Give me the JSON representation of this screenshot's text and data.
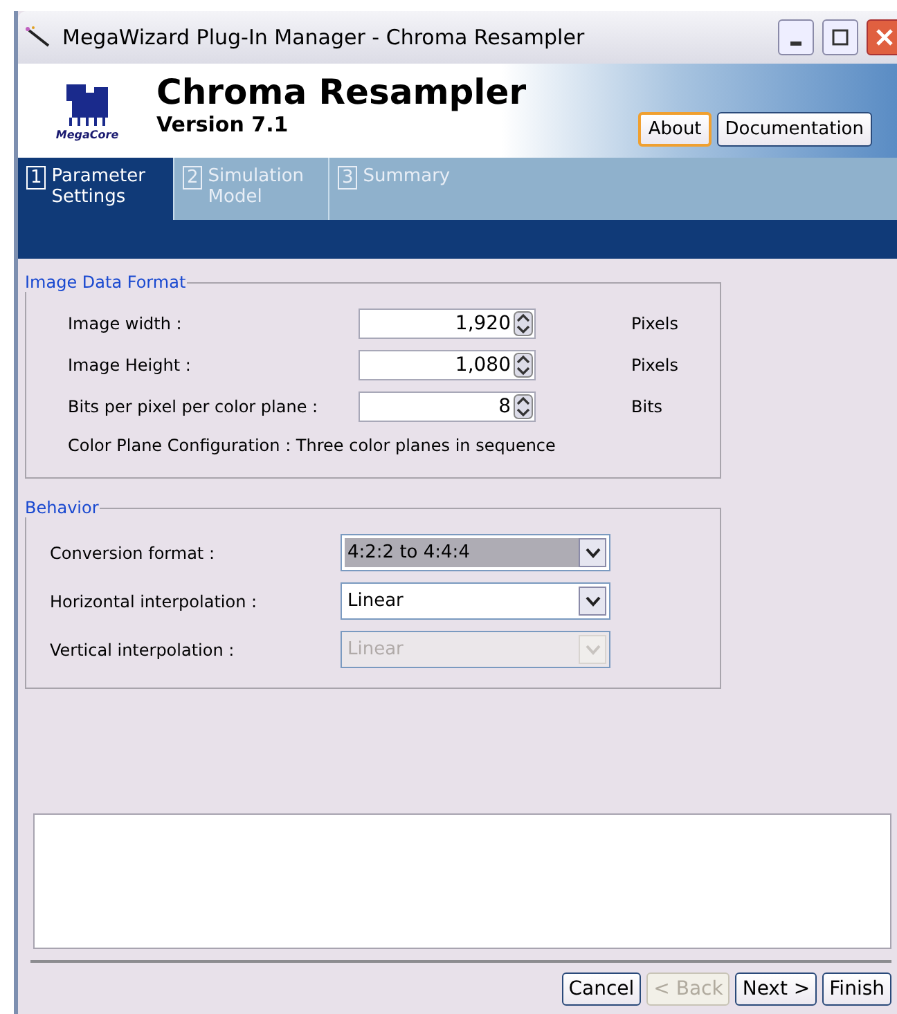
{
  "window": {
    "title": "MegaWizard Plug-In Manager - Chroma Resampler"
  },
  "header": {
    "logo_text": "MegaCore",
    "title": "Chroma Resampler",
    "version": "Version 7.1",
    "buttons": [
      {
        "label": "About",
        "focused": true
      },
      {
        "label": "Documentation",
        "focused": false
      }
    ]
  },
  "tabs": [
    {
      "number": "1",
      "label": "Parameter Settings",
      "selected": true
    },
    {
      "number": "2",
      "label": "Simulation Model",
      "selected": false
    },
    {
      "number": "3",
      "label": "Summary",
      "selected": false
    }
  ],
  "image_data_format": {
    "title": "Image Data Format",
    "fields": [
      {
        "label": "Image width :",
        "value": "1,920",
        "unit": "Pixels"
      },
      {
        "label": "Image Height :",
        "value": "1,080",
        "unit": "Pixels"
      },
      {
        "label": "Bits per pixel per color plane :",
        "value": "8",
        "unit": "Bits"
      }
    ],
    "note": "Color Plane Configuration : Three color planes in sequence"
  },
  "behavior": {
    "title": "Behavior",
    "fields": [
      {
        "label": "Conversion format :",
        "value": "4:2:2 to 4:4:4",
        "selected": true,
        "disabled": false
      },
      {
        "label": "Horizontal interpolation :",
        "value": "Linear",
        "selected": false,
        "disabled": false
      },
      {
        "label": "Vertical interpolation :",
        "value": "Linear",
        "selected": false,
        "disabled": true
      }
    ]
  },
  "footer_buttons": [
    {
      "label": "Cancel",
      "disabled": false
    },
    {
      "label": "< Back",
      "disabled": true
    },
    {
      "label": "Next >",
      "disabled": false
    },
    {
      "label": "Finish",
      "disabled": false
    }
  ]
}
